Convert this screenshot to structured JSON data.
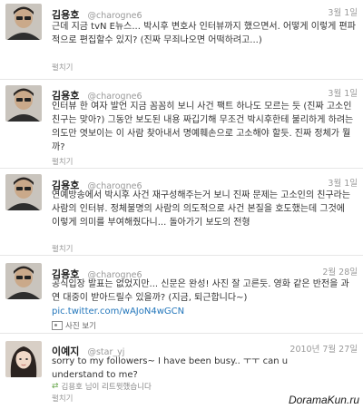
{
  "tweets": [
    {
      "name": "김용호",
      "handle": "@charogne6",
      "date": "3월 1일",
      "text": "근데 지금 tvN E뉴스... 박시후 변호사 인터뷰까지 했으면서. 어떻게 이렇게 편파적으로 편집할수 있지? (진짜 무죄나오면 어떡하려고...)",
      "expand": "펼치기"
    },
    {
      "name": "김용호",
      "handle": "@charogne6",
      "date": "3월 1일",
      "text": "인터뷰 한 여자 발언 지금 꼼꼼히 보니 사건 팩트 하나도 모르는 듯 (진짜 고소인 친구는 맞아?) 그동안 보도된 내용 짜깁기해 무조건 박시후한테 불리하게 하려는 의도만 엿보이는 이 사람 찾아내서 명예훼손으로 고소해야 할듯. 진짜 정체가 뭘까?",
      "expand": "펼치기"
    },
    {
      "name": "김용호",
      "handle": "@charogne6",
      "date": "3월 1일",
      "text": "연예방송에서 박시후 사건 재구성해주는거 보니 진짜 문제는 고소인의 친구라는 사람의 인터뷰. 정체불명의 사람의 의도적으로 사건 본질을 호도했는데 그것에 이렇게 의미를 부여해줬다니... 돌아가기 보도의 전형",
      "expand": "펼치기"
    },
    {
      "name": "김용호",
      "handle": "@charogne6",
      "date": "2월 28일",
      "text": "공식입장 발표는 없었지만... 신문은 완성! 사진 잘 고른듯. 영화 같은 반전을 과연 대중이 받아드릴수 있을까? (지금, 퇴근합니다~)",
      "link": "pic.twitter.com/wAJoN4wGCN",
      "photo": "사진 보기"
    },
    {
      "name": "이예지",
      "handle": "@star_yj",
      "date": "2010년 7월 27일",
      "text": "sorry to my followers~ I have been busy.. ㅜㅜ can u understand to me?",
      "retweet": "김용호 님이 리트윗했습니다",
      "expand": "펼치기"
    }
  ],
  "watermark": "DoramaKun.ru"
}
